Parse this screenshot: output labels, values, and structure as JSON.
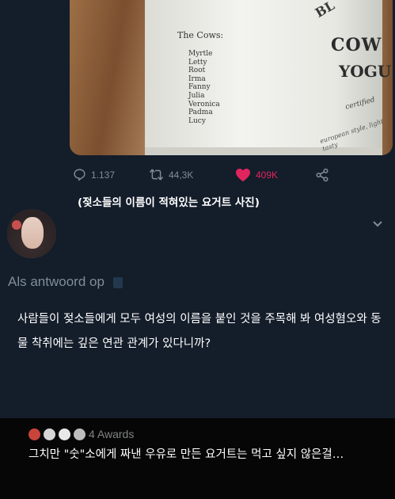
{
  "photo": {
    "list_title": "The Cows:",
    "cow_names": [
      "Myrtle",
      "Letty",
      "Root",
      "Irma",
      "Fanny",
      "Julia",
      "Veronica",
      "Padma",
      "Lucy"
    ],
    "brand_top": "BL",
    "brand_line1": "COW",
    "brand_line2": "YOGU",
    "certified": "certified",
    "style_text": "european style, light tasty"
  },
  "actions": {
    "replies": "1.137",
    "retweets": "44,3K",
    "likes": "409K",
    "like_color": "#e0245e"
  },
  "caption": "(젖소들의 이름이 적혀있는 요거트 사진)",
  "reply": {
    "reply_to_label": "Als antwoord op",
    "text": "사람들이 젖소들에게 모두 여성의 이름을 붙인 것을 주목해 봐 여성혐오와 동물 착취에는 깊은 연관 관계가 있다니까?"
  },
  "reddit": {
    "awards_label": "4 Awards",
    "comment": "그치만 \"숫\"소에게 짜낸 우유로 만든 요거트는 먹고 싶지 않은걸…"
  }
}
